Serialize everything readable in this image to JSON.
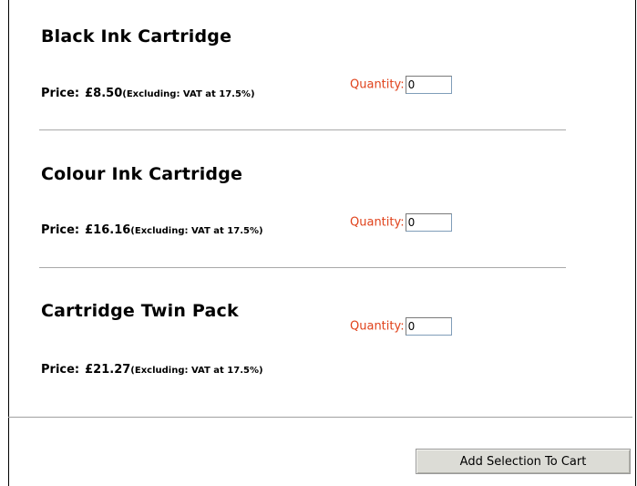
{
  "products": [
    {
      "title": "Black Ink Cartridge",
      "price_label": "Price:",
      "price": "£8.50",
      "vat_note": "(Excluding: VAT at 17.5%)",
      "quantity_label": "Quantity:",
      "quantity_value": "0"
    },
    {
      "title": "Colour Ink Cartridge",
      "price_label": "Price:",
      "price": "£16.16",
      "vat_note": "(Excluding: VAT at 17.5%)",
      "quantity_label": "Quantity:",
      "quantity_value": "0"
    },
    {
      "title": "Cartridge Twin Pack",
      "price_label": "Price:",
      "price": "£21.27",
      "vat_note": "(Excluding: VAT at 17.5%)",
      "quantity_label": "Quantity:",
      "quantity_value": "0"
    }
  ],
  "actions": {
    "add_to_cart_label": "Add Selection To Cart"
  },
  "colors": {
    "quantity_label": "#e0421b",
    "button_bg": "#dcdcd6"
  }
}
